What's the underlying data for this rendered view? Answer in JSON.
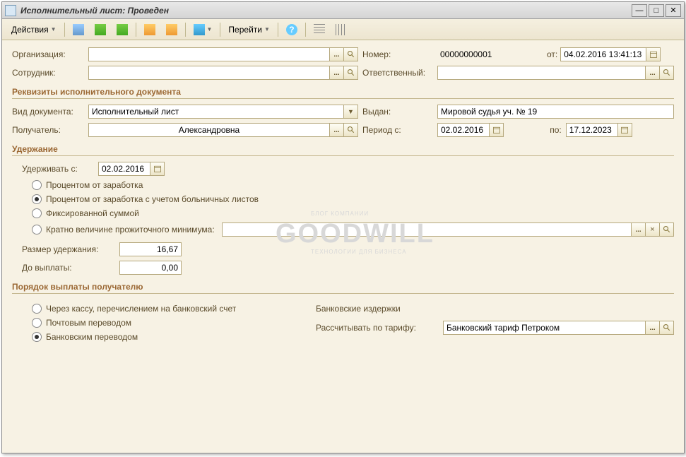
{
  "window": {
    "title": "Исполнительный лист: Проведен"
  },
  "toolbar": {
    "actions": "Действия",
    "goto": "Перейти"
  },
  "header": {
    "org_label": "Организация:",
    "emp_label": "Сотрудник:",
    "num_label": "Номер:",
    "number": "00000000001",
    "date_label": "от:",
    "date_value": "04.02.2016 13:41:13",
    "resp_label": "Ответственный:",
    "resp_value": ""
  },
  "section1": {
    "title": "Реквизиты исполнительного документа",
    "doctype_label": "Вид документа:",
    "doctype_value": "Исполнительный лист",
    "recipient_label": "Получатель:",
    "recipient_value": "Александровна",
    "issued_label": "Выдан:",
    "issued_value": "Мировой судья уч. № 19",
    "period_label": "Период с:",
    "period_from": "02.02.2016",
    "period_to_label": "по:",
    "period_to": "17.12.2023"
  },
  "section2": {
    "title": "Удержание",
    "withhold_label": "Удерживать с:",
    "withhold_date": "02.02.2016",
    "radio_percent": "Процентом от заработка",
    "radio_percent_sick": "Процентом от заработка с учетом больничных листов",
    "radio_fixed": "Фиксированной суммой",
    "radio_minimum": "Кратно величине прожиточного минимума:",
    "size_label": "Размер удержания:",
    "size_value": "16,67",
    "until_label": "До выплаты:",
    "until_value": "0,00"
  },
  "section3": {
    "title": "Порядок выплаты получателю",
    "radio_cash": "Через кассу, перечислением на банковский счет",
    "radio_postal": "Почтовым переводом",
    "radio_bank": "Банковским переводом",
    "bank_costs": "Банковские издержки",
    "tariff_label": "Рассчитывать по тарифу:",
    "tariff_value": "Банковский тариф Петроком"
  },
  "watermark": {
    "main": "GOODWILL",
    "top": "БЛОГ КОМПАНИИ",
    "bottom": "ТЕХНОЛОГИИ ДЛЯ БИЗНЕСА"
  }
}
